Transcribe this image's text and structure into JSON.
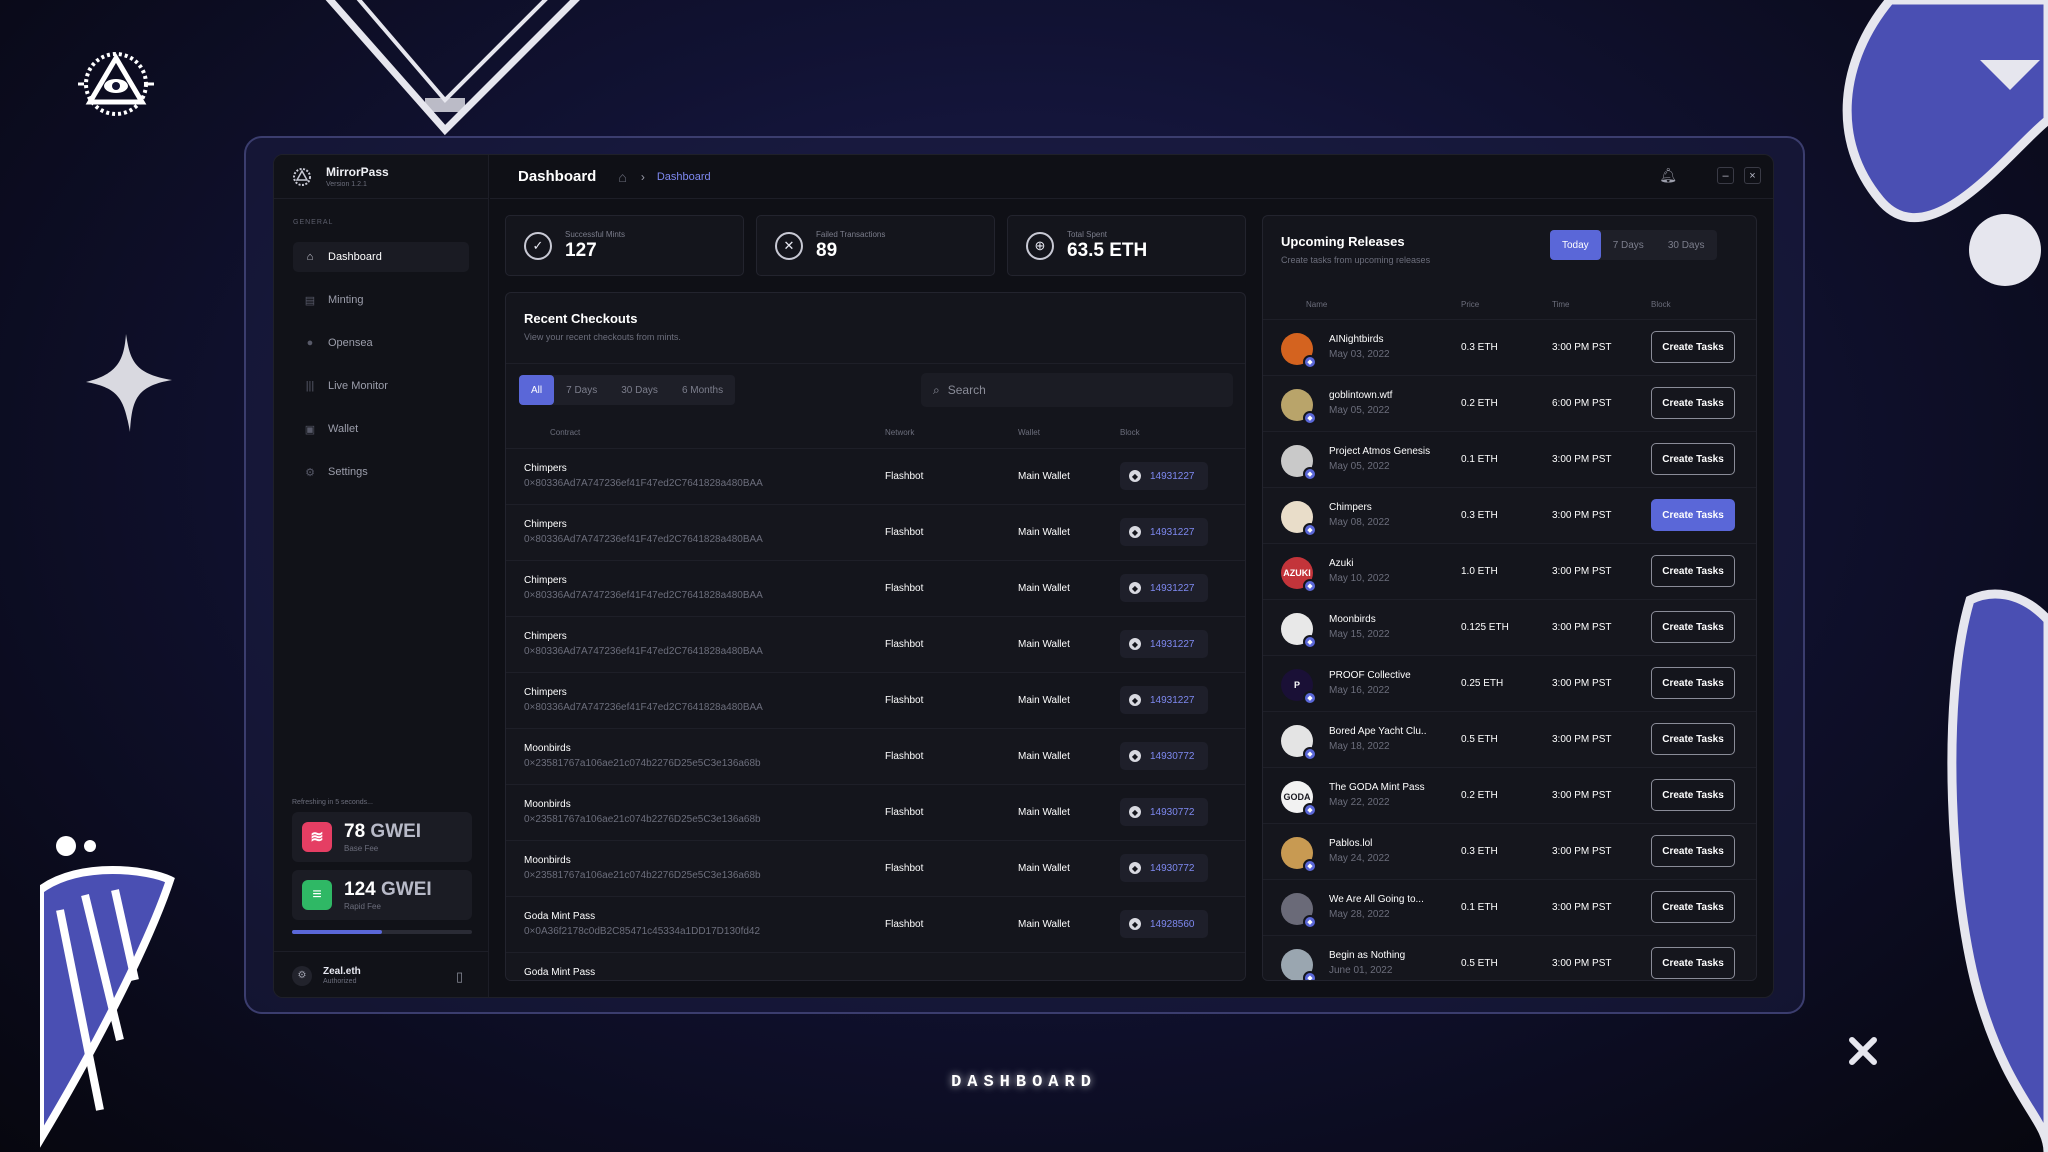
{
  "background_label": "DASHBOARD",
  "sidebar": {
    "app_name": "MirrorPass",
    "version": "Version 1.2.1",
    "section_label": "GENERAL",
    "items": [
      {
        "label": "Dashboard",
        "icon": "home-icon",
        "active": true
      },
      {
        "label": "Minting",
        "icon": "minting-icon",
        "active": false
      },
      {
        "label": "Opensea",
        "icon": "opensea-icon",
        "active": false
      },
      {
        "label": "Live Monitor",
        "icon": "live-monitor-icon",
        "active": false
      },
      {
        "label": "Wallet",
        "icon": "wallet-icon",
        "active": false
      },
      {
        "label": "Settings",
        "icon": "gear-icon",
        "active": false
      }
    ],
    "refresh_text": "Refreshing in 5 seconds...",
    "base_fee": {
      "value": "78",
      "unit": "GWEI",
      "label": "Base Fee",
      "color": "#e53e63"
    },
    "rapid_fee": {
      "value": "124",
      "unit": "GWEI",
      "label": "Rapid Fee",
      "color": "#2fb865"
    },
    "refresh_progress": 0.5,
    "user": {
      "name": "Zeal.eth",
      "status": "Authorized"
    }
  },
  "topbar": {
    "title": "Dashboard",
    "breadcrumb": "Dashboard"
  },
  "stats": [
    {
      "label": "Successful Mints",
      "value": "127",
      "icon": "check-circle-icon"
    },
    {
      "label": "Failed Transactions",
      "value": "89",
      "icon": "x-circle-icon"
    },
    {
      "label": "Total Spent",
      "value": "63.5 ETH",
      "icon": "globe-icon"
    }
  ],
  "checkouts": {
    "title": "Recent Checkouts",
    "subtitle": "View your recent checkouts from mints.",
    "filters": [
      "All",
      "7 Days",
      "30 Days",
      "6 Months"
    ],
    "active_filter": "All",
    "search_placeholder": "Search",
    "columns": [
      "Contract",
      "Network",
      "Wallet",
      "Block"
    ],
    "rows": [
      {
        "name": "Chimpers",
        "address": "0×80336Ad7A747236ef41F47ed2C7641828a480BAA",
        "network": "Flashbot",
        "wallet": "Main Wallet",
        "block": "14931227"
      },
      {
        "name": "Chimpers",
        "address": "0×80336Ad7A747236ef41F47ed2C7641828a480BAA",
        "network": "Flashbot",
        "wallet": "Main Wallet",
        "block": "14931227"
      },
      {
        "name": "Chimpers",
        "address": "0×80336Ad7A747236ef41F47ed2C7641828a480BAA",
        "network": "Flashbot",
        "wallet": "Main Wallet",
        "block": "14931227"
      },
      {
        "name": "Chimpers",
        "address": "0×80336Ad7A747236ef41F47ed2C7641828a480BAA",
        "network": "Flashbot",
        "wallet": "Main Wallet",
        "block": "14931227"
      },
      {
        "name": "Chimpers",
        "address": "0×80336Ad7A747236ef41F47ed2C7641828a480BAA",
        "network": "Flashbot",
        "wallet": "Main Wallet",
        "block": "14931227"
      },
      {
        "name": "Moonbirds",
        "address": "0×23581767a106ae21c074b2276D25e5C3e136a68b",
        "network": "Flashbot",
        "wallet": "Main Wallet",
        "block": "14930772"
      },
      {
        "name": "Moonbirds",
        "address": "0×23581767a106ae21c074b2276D25e5C3e136a68b",
        "network": "Flashbot",
        "wallet": "Main Wallet",
        "block": "14930772"
      },
      {
        "name": "Moonbirds",
        "address": "0×23581767a106ae21c074b2276D25e5C3e136a68b",
        "network": "Flashbot",
        "wallet": "Main Wallet",
        "block": "14930772"
      },
      {
        "name": "Goda Mint Pass",
        "address": "0×0A36f2178c0dB2C85471c45334a1DD17D130fd42",
        "network": "Flashbot",
        "wallet": "Main Wallet",
        "block": "14928560"
      },
      {
        "name": "Goda Mint Pass",
        "address": "",
        "network": "",
        "wallet": "",
        "block": ""
      }
    ]
  },
  "releases": {
    "title": "Upcoming Releases",
    "subtitle": "Create tasks from upcoming releases",
    "filters": [
      "Today",
      "7 Days",
      "30 Days"
    ],
    "active_filter": "Today",
    "columns": [
      "Name",
      "Price",
      "Time",
      "Block"
    ],
    "button_label": "Create Tasks",
    "rows": [
      {
        "name": "AINightbirds",
        "date": "May 03, 2022",
        "price": "0.3 ETH",
        "time": "3:00 PM PST",
        "avatar_color": "#d4631f",
        "avatar_text": "",
        "highlight": false
      },
      {
        "name": "goblintown.wtf",
        "date": "May 05, 2022",
        "price": "0.2 ETH",
        "time": "6:00 PM PST",
        "avatar_color": "#b9a46a",
        "avatar_text": "",
        "highlight": false
      },
      {
        "name": "Project Atmos Genesis",
        "date": "May 05, 2022",
        "price": "0.1 ETH",
        "time": "3:00 PM PST",
        "avatar_color": "#c9c9c9",
        "avatar_text": "",
        "highlight": false
      },
      {
        "name": "Chimpers",
        "date": "May 08, 2022",
        "price": "0.3 ETH",
        "time": "3:00 PM PST",
        "avatar_color": "#e9ddc9",
        "avatar_text": "",
        "highlight": true
      },
      {
        "name": "Azuki",
        "date": "May 10, 2022",
        "price": "1.0 ETH",
        "time": "3:00 PM PST",
        "avatar_color": "#c3343a",
        "avatar_text": "AZUKI",
        "highlight": false
      },
      {
        "name": "Moonbirds",
        "date": "May 15, 2022",
        "price": "0.125 ETH",
        "time": "3:00 PM PST",
        "avatar_color": "#e8e8e8",
        "avatar_text": "",
        "highlight": false
      },
      {
        "name": "PROOF Collective",
        "date": "May 16, 2022",
        "price": "0.25 ETH",
        "time": "3:00 PM PST",
        "avatar_color": "#1a1036",
        "avatar_text": "P",
        "highlight": false
      },
      {
        "name": "Bored Ape Yacht Clu..",
        "date": "May 18, 2022",
        "price": "0.5 ETH",
        "time": "3:00 PM PST",
        "avatar_color": "#e4e4e4",
        "avatar_text": "",
        "highlight": false
      },
      {
        "name": "The GODA Mint Pass",
        "date": "May 22, 2022",
        "price": "0.2 ETH",
        "time": "3:00 PM PST",
        "avatar_color": "#f2f2f2",
        "avatar_text": "GODA",
        "highlight": false
      },
      {
        "name": "Pablos.lol",
        "date": "May 24, 2022",
        "price": "0.3 ETH",
        "time": "3:00 PM PST",
        "avatar_color": "#c89a52",
        "avatar_text": "",
        "highlight": false
      },
      {
        "name": "We Are All Going to...",
        "date": "May 28, 2022",
        "price": "0.1 ETH",
        "time": "3:00 PM PST",
        "avatar_color": "#6a6a78",
        "avatar_text": "",
        "highlight": false
      },
      {
        "name": "Begin as Nothing",
        "date": "June 01, 2022",
        "price": "0.5 ETH",
        "time": "3:00 PM PST",
        "avatar_color": "#9aa6b0",
        "avatar_text": "",
        "highlight": false
      }
    ]
  }
}
